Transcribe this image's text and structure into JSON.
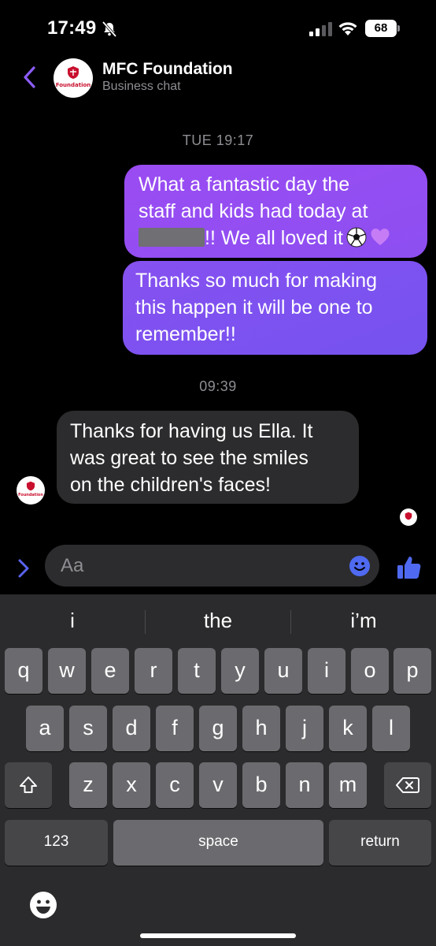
{
  "status_bar": {
    "time": "17:49",
    "battery": "68",
    "icons": [
      "bell-slash-icon",
      "cellular-signal-icon",
      "wifi-icon",
      "battery-icon"
    ]
  },
  "header": {
    "back_icon": "chevron-left-icon",
    "contact_name": "MFC Foundation",
    "subtitle": "Business chat",
    "avatar_text": "Foundation"
  },
  "messages": {
    "timestamp_1": "TUE 19:17",
    "outgoing": [
      {
        "lines": [
          "What a fantastic day the",
          "staff and kids had today at",
          "!! We all loved it"
        ],
        "emoji": [
          "soccer-ball-icon",
          "purple-heart-icon"
        ]
      },
      {
        "lines": [
          "Thanks so much for making",
          "this happen it will be one to",
          "remember!!"
        ]
      }
    ],
    "timestamp_2": "09:39",
    "incoming": {
      "lines": [
        "Thanks for having us Ella. It",
        "was great to see the smiles",
        "on the children's faces!"
      ]
    }
  },
  "composer": {
    "placeholder": "Aa",
    "expand_icon": "chevron-right-icon",
    "emoji_icon": "smiley-icon",
    "like_icon": "thumbs-up-icon"
  },
  "keyboard": {
    "suggestions": [
      "i",
      "the",
      "i’m"
    ],
    "row1": [
      "q",
      "w",
      "e",
      "r",
      "t",
      "y",
      "u",
      "i",
      "o",
      "p"
    ],
    "row2": [
      "a",
      "s",
      "d",
      "f",
      "g",
      "h",
      "j",
      "k",
      "l"
    ],
    "row3": [
      "z",
      "x",
      "c",
      "v",
      "b",
      "n",
      "m"
    ],
    "numbers_label": "123",
    "space_label": "space",
    "return_label": "return",
    "colors": {
      "accent": "#8b4ff1",
      "key": "#6b6b6f",
      "key_dark": "#464649",
      "background": "#2b2b2d"
    }
  }
}
